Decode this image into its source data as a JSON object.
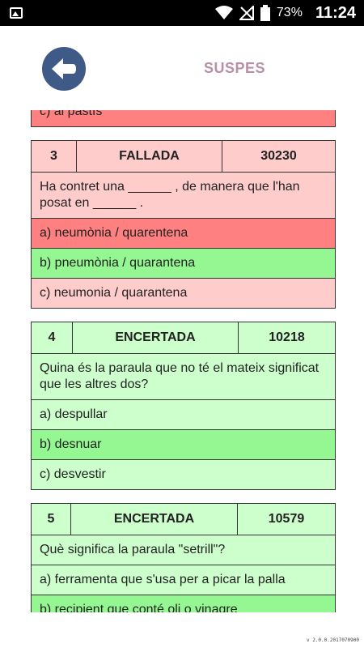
{
  "status": {
    "battery": "73%",
    "time": "11:24"
  },
  "header": {
    "title": "SUSPES"
  },
  "cards": [
    {
      "options": [
        "c) al pastís"
      ]
    },
    {
      "number": "3",
      "result": "FALLADA",
      "id": "30230",
      "question": "Ha contret una ______ , de manera que l'han posat en ______ .",
      "options": [
        "a) neumònia / quarentena",
        "b) pneumònia / quarantena",
        "c) neumonia / quarantena"
      ]
    },
    {
      "number": "4",
      "result": "ENCERTADA",
      "id": "10218",
      "question": "Quina és la paraula que no té el mateix significat que les altres dos?",
      "options": [
        "a) despullar",
        "b) desnuar",
        "c) desvestir"
      ]
    },
    {
      "number": "5",
      "result": "ENCERTADA",
      "id": "10579",
      "question": "Què significa la paraula \"setrill\"?",
      "options": [
        "a) ferramenta que s'usa per a picar la palla",
        "b) recipient que conté oli o vinagre"
      ]
    }
  ],
  "footer": {
    "version": "v 2.0.0.2017070900"
  },
  "colors": {
    "wrong": "#ff8080",
    "right": "#95f792",
    "fail_bg": "#ffcccc",
    "ok_bg": "#ccffcc",
    "accent": "#3f5a87"
  }
}
